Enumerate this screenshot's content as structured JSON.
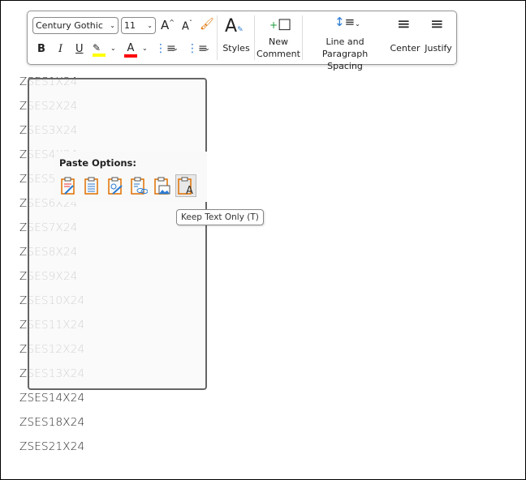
{
  "document": {
    "lines": [
      "ZSES1X24",
      "ZSES2X24",
      "ZSES3X24",
      "ZSES4X24",
      "ZSES5X24",
      "ZSES6X24",
      "ZSES7X24",
      "ZSES8X24",
      "ZSES9X24",
      "ZSES10X24",
      "ZSES11X24",
      "ZSES12X24",
      "ZSES13X24",
      "ZSES14X24",
      "ZSES18X24",
      "ZSES21X24"
    ]
  },
  "toolbar": {
    "font": "Century Gothic",
    "size": "11",
    "bold": "B",
    "italic": "I",
    "underline": "U",
    "styles": "Styles",
    "new_comment_1": "New",
    "new_comment_2": "Comment",
    "spacing_1": "Line and",
    "spacing_2": "Paragraph Spacing",
    "center": "Center",
    "justify": "Justify",
    "highlight_color": "#ffff00",
    "font_color": "#ff0000"
  },
  "paste": {
    "title": "Paste Options:",
    "tooltip": "Keep Text Only (T)",
    "options": [
      "keep-source-formatting",
      "merge-formatting",
      "use-destination-styles",
      "link",
      "picture",
      "keep-text-only"
    ],
    "accent": "#e07000"
  }
}
